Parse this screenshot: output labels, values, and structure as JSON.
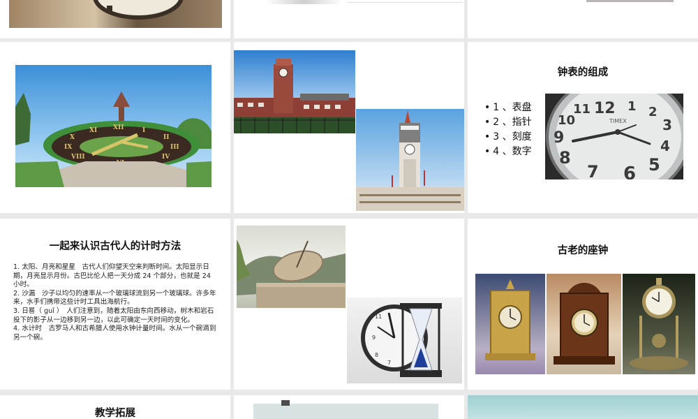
{
  "slides": {
    "composition": {
      "title": "钟表的组成",
      "items": [
        "1 、表盘",
        "2 、指针",
        "3 、刻度",
        "4 、数字"
      ]
    },
    "ancient": {
      "title": "一起来认识古代人的计时方法",
      "paragraphs": [
        "1. 太阳、月亮和星星　古代人们仰望天空来判断时间。太阳显示日期，月亮显示月份。古巴比伦人把一天分成 24 个部分，也就是 24 小时。",
        "2. 沙漏　沙子以均匀的速率从一个玻璃球流到另一个玻璃球。许多年来，水手们携带这些计时工具出海航行。",
        "3. 日晷（ guǐ ）　人们注意到，随着太阳由东向西移动，树木和岩石投下的影子从一边移到另一边，以此可确定一天时间的变化。",
        "4. 水计时　古罗马人和古希腊人使用水钟计量时间。水从一个碗滴到另一个碗。"
      ]
    },
    "old_clocks": {
      "title": "古老的座钟"
    },
    "extension": {
      "title": "教学拓展"
    }
  },
  "icons": {
    "wall_clock_brand": "TIMEX",
    "numerals": [
      "12",
      "1",
      "2",
      "3",
      "4",
      "5",
      "6",
      "7",
      "8",
      "9",
      "10",
      "11"
    ]
  },
  "colors": {
    "background": "#e9e9e9",
    "slide": "#ffffff",
    "text": "#111111"
  }
}
